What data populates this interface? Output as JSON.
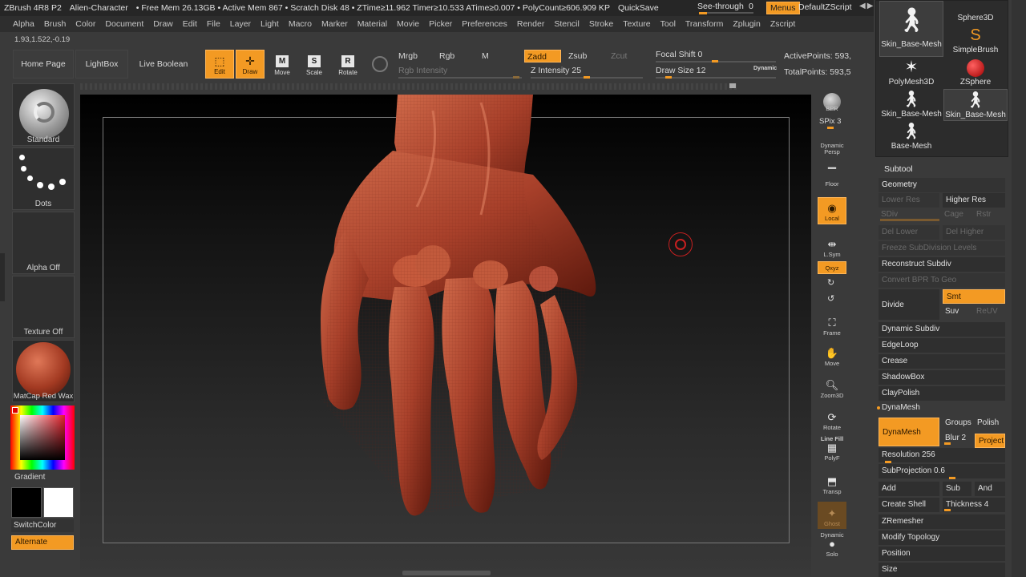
{
  "titlebar": {
    "app": "ZBrush 4R8 P2",
    "document": "Alien-Character",
    "stats": "• Free Mem 26.13GB • Active Mem 867 • Scratch Disk 48 • ZTime≥11.962 Timer≥10.533 ATime≥0.007 • PolyCount≥606.909 KP",
    "quicksave": "QuickSave",
    "see_through_label": "See-through",
    "see_through_value": "0",
    "see_through_level": 0,
    "menus": "Menus",
    "default_zscript": "DefaultZScript"
  },
  "menubar": {
    "items": [
      "Alpha",
      "Brush",
      "Color",
      "Document",
      "Draw",
      "Edit",
      "File",
      "Layer",
      "Light",
      "Macro",
      "Marker",
      "Material",
      "Movie",
      "Picker",
      "Preferences",
      "Render",
      "Stencil",
      "Stroke",
      "Texture",
      "Tool",
      "Transform",
      "Zplugin",
      "Zscript"
    ]
  },
  "coords": "1.93,1.522,-0.19",
  "shelf": {
    "home_page": "Home Page",
    "lightbox": "LightBox",
    "live_boolean": "Live Boolean",
    "edit": "Edit",
    "draw": "Draw",
    "move": "Move",
    "scale": "Scale",
    "rotate": "Rotate",
    "mrgb": "Mrgb",
    "rgb": "Rgb",
    "m": "M",
    "zadd": "Zadd",
    "zsub": "Zsub",
    "zcut": "Zcut",
    "rgb_intensity": "Rgb Intensity",
    "z_intensity_label": "Z Intensity",
    "z_intensity_value": "25",
    "focal_shift_label": "Focal Shift",
    "focal_shift_value": "0",
    "draw_size_label": "Draw Size",
    "draw_size_value": "12",
    "dynamic": "Dynamic",
    "active_points": "ActivePoints: 593,",
    "total_points": "TotalPoints: 593,5"
  },
  "leftpanel": {
    "brush": "Standard",
    "stroke": "Dots",
    "alpha": "Alpha Off",
    "texture": "Texture Off",
    "material": "MatCap Red Wax",
    "gradient": "Gradient",
    "switchcolor": "SwitchColor",
    "alternate": "Alternate"
  },
  "rightdock": {
    "bpr": "BPR",
    "spix": "SPix 3",
    "dynamic_persp": "Dynamic Persp",
    "floor": "Floor",
    "local": "Local",
    "lsym": "L.Sym",
    "qxyz": "Qxyz",
    "frame": "Frame",
    "move": "Move",
    "zoom3d": "Zoom3D",
    "rotate": "Rotate",
    "linefill": "Line Fill",
    "polyf": "PolyF",
    "transp": "Transp",
    "ghost": "Ghost",
    "dynamic": "Dynamic",
    "solo": "Solo"
  },
  "toolgrid": {
    "items": [
      "Skin_Base-Mesh",
      "SimpleBrush",
      "PolyMesh3D",
      "ZSphere",
      "Skin_Base-Mesh",
      "Skin_Base-Mesh",
      "Base-Mesh"
    ],
    "sphere3d": "Sphere3D"
  },
  "palette": {
    "subtool": "Subtool",
    "geometry": "Geometry",
    "lower_res": "Lower Res",
    "higher_res": "Higher Res",
    "sdiv": "SDiv",
    "cage": "Cage",
    "rstr": "Rstr",
    "del_lower": "Del Lower",
    "del_higher": "Del Higher",
    "freeze": "Freeze SubDivision Levels",
    "reconstruct": "Reconstruct Subdiv",
    "convert_bpr": "Convert BPR To Geo",
    "divide": "Divide",
    "smt": "Smt",
    "suv": "Suv",
    "reuv": "ReUV",
    "dynamic_subdiv": "Dynamic Subdiv",
    "edgeloop": "EdgeLoop",
    "crease": "Crease",
    "shadowbox": "ShadowBox",
    "claypolish": "ClayPolish",
    "dynamesh_head": "DynaMesh",
    "dynamesh_btn": "DynaMesh",
    "groups": "Groups",
    "polish": "Polish",
    "blur": "Blur 2",
    "project": "Project",
    "resolution_label": "Resolution",
    "resolution_value": "256",
    "subprojection_label": "SubProjection",
    "subprojection_value": "0.6",
    "add": "Add",
    "sub": "Sub",
    "and": "And",
    "create_shell": "Create Shell",
    "thickness_label": "Thickness",
    "thickness_value": "4",
    "zremesher": "ZRemesher",
    "modify_topology": "Modify Topology",
    "position": "Position",
    "size": "Size"
  },
  "colors": {
    "accent": "#f39a23",
    "panel": "#3a3a3a",
    "dark": "#262626",
    "clay": "#b34a2c"
  }
}
